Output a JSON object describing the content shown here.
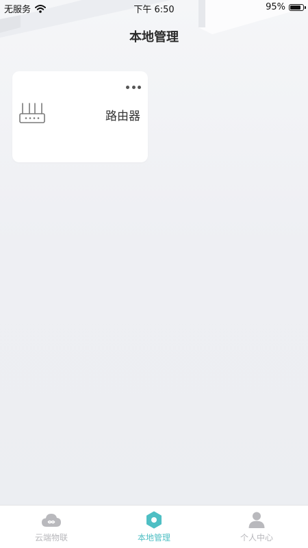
{
  "status_bar": {
    "carrier": "无服务",
    "time": "下午 6:50",
    "battery_percent": "95%",
    "battery_level": 0.95
  },
  "header": {
    "title": "本地管理"
  },
  "devices": [
    {
      "name": "路由器",
      "icon": "router-icon"
    }
  ],
  "tabbar": {
    "active_index": 1,
    "active_color": "#4fbfc4",
    "inactive_color": "#b7b7bb",
    "items": [
      {
        "label": "云端物联",
        "icon": "cloud-icon"
      },
      {
        "label": "本地管理",
        "icon": "hexagon-icon"
      },
      {
        "label": "个人中心",
        "icon": "person-icon"
      }
    ]
  }
}
